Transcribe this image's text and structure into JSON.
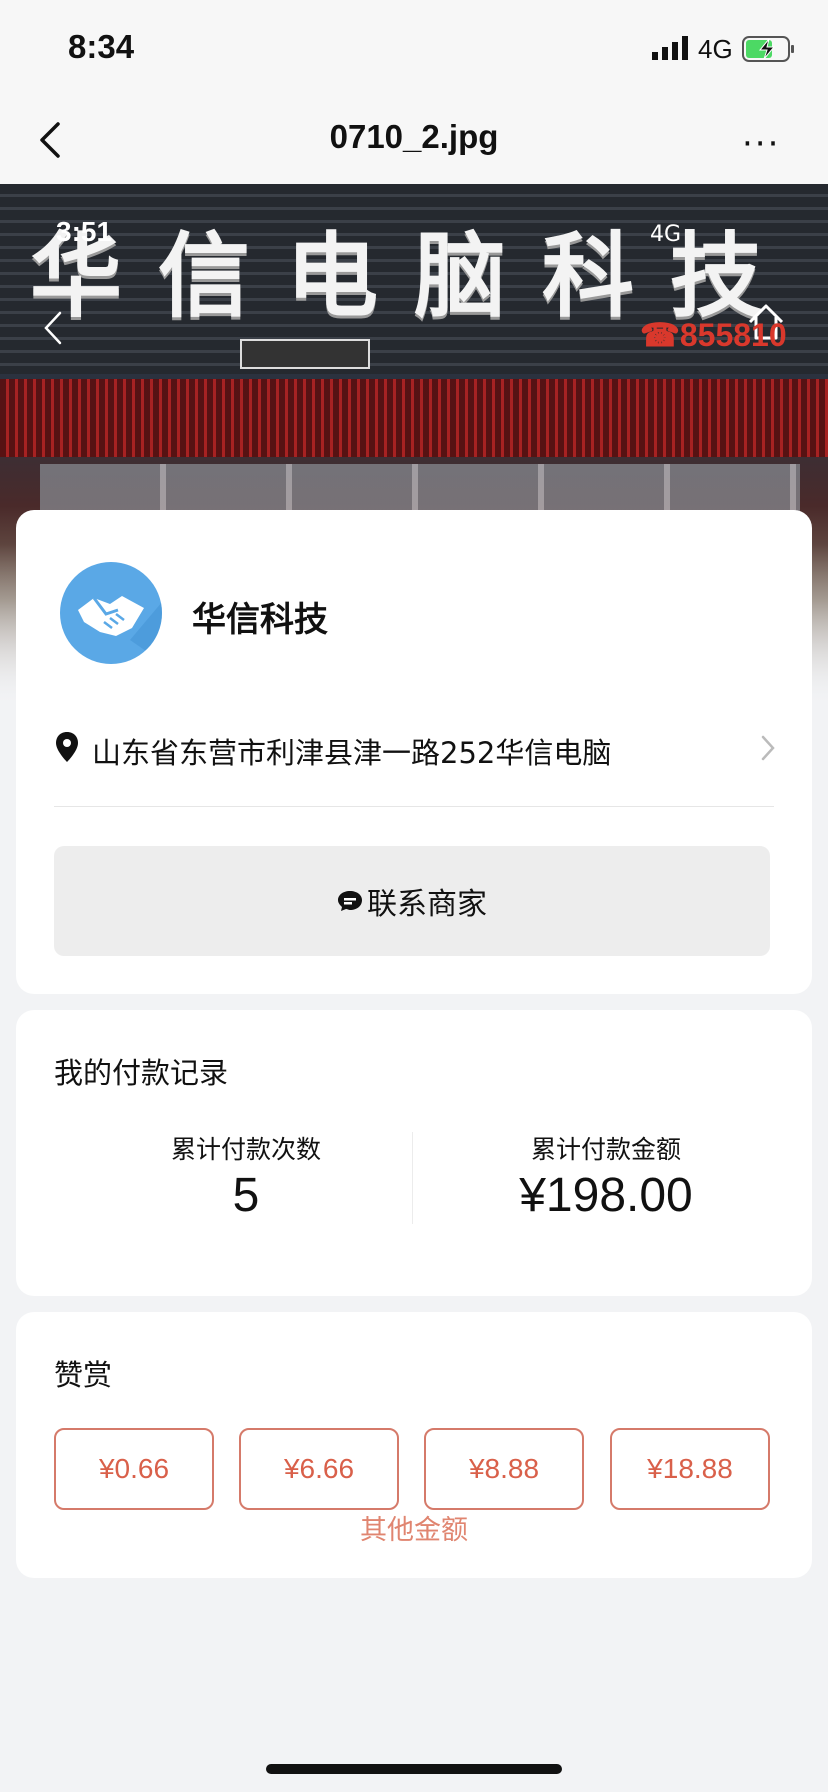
{
  "status_bar": {
    "time": "8:34",
    "network": "4G",
    "battery_icon": "battery-charging-icon"
  },
  "nav": {
    "title": "0710_2.jpg",
    "more": "···"
  },
  "hero": {
    "sign_text": "华信电脑科技",
    "inner_time": "3:51",
    "inner_network": "4G",
    "phone": "☎855810"
  },
  "merchant": {
    "name": "华信科技",
    "address": "山东省东营市利津县津一路252华信电脑",
    "contact_label": "联系商家",
    "avatar_color": "#5aa8e6"
  },
  "payments": {
    "title": "我的付款记录",
    "count_label": "累计付款次数",
    "count_value": "5",
    "amount_label": "累计付款金额",
    "amount_value": "¥198.00"
  },
  "tip": {
    "title": "赞赏",
    "amounts": [
      "¥0.66",
      "¥6.66",
      "¥8.88",
      "¥18.88"
    ],
    "other_label": "其他金额",
    "accent_color": "#d9604a"
  }
}
